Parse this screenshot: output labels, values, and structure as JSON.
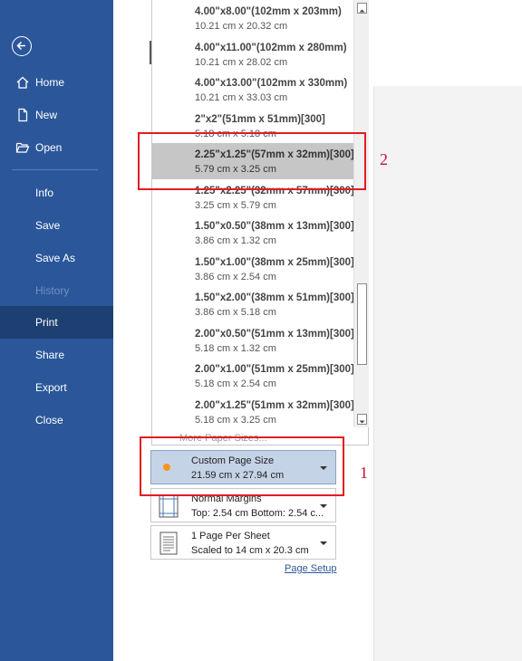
{
  "sidebar": {
    "items": [
      {
        "label": "Home",
        "icon": "home-icon"
      },
      {
        "label": "New",
        "icon": "new-document-icon"
      },
      {
        "label": "Open",
        "icon": "open-folder-icon"
      },
      {
        "label": "Info"
      },
      {
        "label": "Save"
      },
      {
        "label": "Save As"
      },
      {
        "label": "History"
      },
      {
        "label": "Print"
      },
      {
        "label": "Share"
      },
      {
        "label": "Export"
      },
      {
        "label": "Close"
      }
    ]
  },
  "paper_sizes": [
    {
      "name": "4.00\"x8.00\"(102mm x 203mm)",
      "dim": "10.21 cm x 20.32 cm"
    },
    {
      "name": "4.00\"x11.00\"(102mm x 280mm)",
      "dim": "10.21 cm x 28.02 cm"
    },
    {
      "name": "4.00\"x13.00\"(102mm x 330mm)",
      "dim": "10.21 cm x 33.03 cm"
    },
    {
      "name": "2\"x2\"(51mm x 51mm)[300]",
      "dim": "5.18 cm x 5.18 cm"
    },
    {
      "name": "2.25\"x1.25\"(57mm x 32mm)[300]",
      "dim": "5.79 cm x 3.25 cm"
    },
    {
      "name": "1.25\"x2.25\"(32mm x 57mm)[300]",
      "dim": "3.25 cm x 5.79 cm"
    },
    {
      "name": "1.50\"x0.50\"(38mm x 13mm)[300]",
      "dim": "3.86 cm x 1.32 cm"
    },
    {
      "name": "1.50\"x1.00\"(38mm x 25mm)[300]",
      "dim": "3.86 cm x 2.54 cm"
    },
    {
      "name": "1.50\"x2.00\"(38mm x 51mm)[300]",
      "dim": "3.86 cm x 5.18 cm"
    },
    {
      "name": "2.00\"x0.50\"(51mm x 13mm)[300]",
      "dim": "5.18 cm x 1.32 cm"
    },
    {
      "name": "2.00\"x1.00\"(51mm x 25mm)[300]",
      "dim": "5.18 cm x 2.54 cm"
    },
    {
      "name": "2.00\"x1.25\"(51mm x 32mm)[300]",
      "dim": "5.18 cm x 3.25 cm"
    }
  ],
  "more_paper_sizes": "More Paper Sizes...",
  "settings": {
    "page_size": {
      "title": "Custom Page Size",
      "detail": "21.59 cm x 27.94 cm"
    },
    "margins": {
      "title": "Normal Margins",
      "detail": "Top: 2.54 cm Bottom: 2.54 c..."
    },
    "pages_per_sheet": {
      "title": "1 Page Per Sheet",
      "detail": "Scaled to 14 cm x 20.3 cm"
    }
  },
  "page_setup_link": "Page Setup",
  "annotations": {
    "one": "1",
    "two": "2"
  },
  "colors": {
    "sidebar": "#2b579a",
    "active": "#1e3f72",
    "annotation": "#e31b23",
    "highlight": "#c5d3e6",
    "selected": "#c6c6c6"
  }
}
